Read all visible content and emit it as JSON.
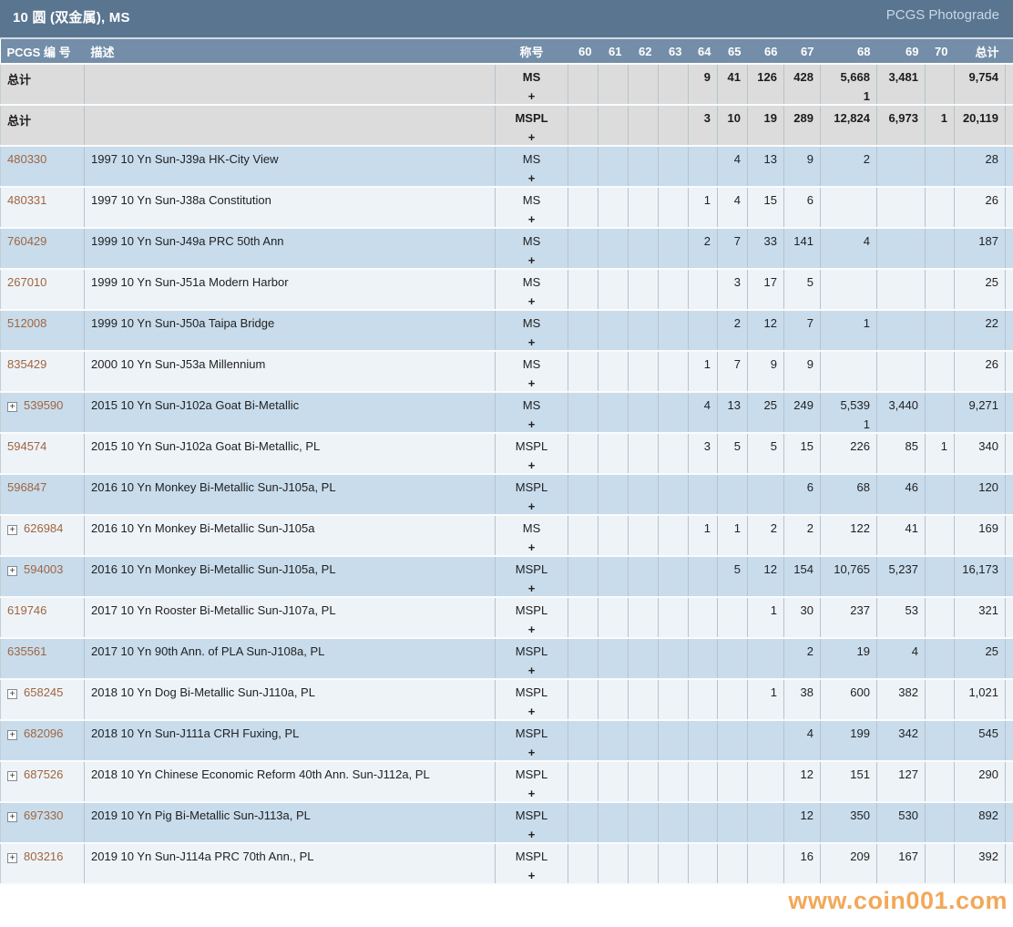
{
  "header": {
    "title": "10 圆 (双金属), MS",
    "photograde_link": "PCGS Photograde"
  },
  "watermark": "www.coin001.com",
  "colors": {
    "titlebar_bg": "#5a7590",
    "table_header_bg": "#748ea9",
    "totals_row_bg": "#dcdcdc",
    "row_blue": "#c8dcec",
    "row_white": "#eef3f8",
    "link": "#a0653f",
    "watermark": "#f09a3e"
  },
  "table": {
    "columns": [
      "PCGS 编 号",
      "描述",
      "称号",
      "60",
      "61",
      "62",
      "63",
      "64",
      "65",
      "66",
      "67",
      "68",
      "69",
      "70",
      "总计"
    ],
    "column_keys": [
      "pcgs",
      "description",
      "designation",
      "60",
      "61",
      "62",
      "63",
      "64",
      "65",
      "66",
      "67",
      "68",
      "69",
      "70",
      "total"
    ],
    "totals_rows": [
      {
        "label": "总计",
        "designation": "MS",
        "plus": "+",
        "values": [
          "",
          "",
          "",
          "",
          "9",
          "41",
          "126",
          "428",
          "5,668",
          "3,481",
          "",
          "9,754"
        ],
        "plus_values": [
          "",
          "",
          "",
          "",
          "",
          "",
          "",
          "",
          "1",
          "",
          "",
          ""
        ]
      },
      {
        "label": "总计",
        "designation": "MSPL",
        "plus": "+",
        "values": [
          "",
          "",
          "",
          "",
          "3",
          "10",
          "19",
          "289",
          "12,824",
          "6,973",
          "1",
          "20,119"
        ],
        "plus_values": [
          "",
          "",
          "",
          "",
          "",
          "",
          "",
          "",
          "",
          "",
          "",
          ""
        ]
      }
    ],
    "rows": [
      {
        "pcgs_number": "480330",
        "expandable": false,
        "description": "1997 10 Yn Sun-J39a HK-City View",
        "designation": "MS",
        "plus": "+",
        "values": [
          "",
          "",
          "",
          "",
          "",
          "4",
          "13",
          "9",
          "2",
          "",
          "",
          "28"
        ],
        "plus_values": [
          "",
          "",
          "",
          "",
          "",
          "",
          "",
          "",
          "",
          "",
          "",
          ""
        ]
      },
      {
        "pcgs_number": "480331",
        "expandable": false,
        "description": "1997 10 Yn Sun-J38a Constitution",
        "designation": "MS",
        "plus": "+",
        "values": [
          "",
          "",
          "",
          "",
          "1",
          "4",
          "15",
          "6",
          "",
          "",
          "",
          "26"
        ],
        "plus_values": [
          "",
          "",
          "",
          "",
          "",
          "",
          "",
          "",
          "",
          "",
          "",
          ""
        ]
      },
      {
        "pcgs_number": "760429",
        "expandable": false,
        "description": "1999 10 Yn Sun-J49a PRC 50th Ann",
        "designation": "MS",
        "plus": "+",
        "values": [
          "",
          "",
          "",
          "",
          "2",
          "7",
          "33",
          "141",
          "4",
          "",
          "",
          "187"
        ],
        "plus_values": [
          "",
          "",
          "",
          "",
          "",
          "",
          "",
          "",
          "",
          "",
          "",
          ""
        ]
      },
      {
        "pcgs_number": "267010",
        "expandable": false,
        "description": "1999 10 Yn Sun-J51a Modern Harbor",
        "designation": "MS",
        "plus": "+",
        "values": [
          "",
          "",
          "",
          "",
          "",
          "3",
          "17",
          "5",
          "",
          "",
          "",
          "25"
        ],
        "plus_values": [
          "",
          "",
          "",
          "",
          "",
          "",
          "",
          "",
          "",
          "",
          "",
          ""
        ]
      },
      {
        "pcgs_number": "512008",
        "expandable": false,
        "description": "1999 10 Yn Sun-J50a Taipa Bridge",
        "designation": "MS",
        "plus": "+",
        "values": [
          "",
          "",
          "",
          "",
          "",
          "2",
          "12",
          "7",
          "1",
          "",
          "",
          "22"
        ],
        "plus_values": [
          "",
          "",
          "",
          "",
          "",
          "",
          "",
          "",
          "",
          "",
          "",
          ""
        ]
      },
      {
        "pcgs_number": "835429",
        "expandable": false,
        "description": "2000 10 Yn Sun-J53a Millennium",
        "designation": "MS",
        "plus": "+",
        "values": [
          "",
          "",
          "",
          "",
          "1",
          "7",
          "9",
          "9",
          "",
          "",
          "",
          "26"
        ],
        "plus_values": [
          "",
          "",
          "",
          "",
          "",
          "",
          "",
          "",
          "",
          "",
          "",
          ""
        ]
      },
      {
        "pcgs_number": "539590",
        "expandable": true,
        "description": "2015 10 Yn Sun-J102a Goat Bi-Metallic",
        "designation": "MS",
        "plus": "+",
        "values": [
          "",
          "",
          "",
          "",
          "4",
          "13",
          "25",
          "249",
          "5,539",
          "3,440",
          "",
          "9,271"
        ],
        "plus_values": [
          "",
          "",
          "",
          "",
          "",
          "",
          "",
          "",
          "1",
          "",
          "",
          ""
        ]
      },
      {
        "pcgs_number": "594574",
        "expandable": false,
        "description": "2015 10 Yn Sun-J102a Goat Bi-Metallic, PL",
        "designation": "MSPL",
        "plus": "+",
        "values": [
          "",
          "",
          "",
          "",
          "3",
          "5",
          "5",
          "15",
          "226",
          "85",
          "1",
          "340"
        ],
        "plus_values": [
          "",
          "",
          "",
          "",
          "",
          "",
          "",
          "",
          "",
          "",
          "",
          ""
        ]
      },
      {
        "pcgs_number": "596847",
        "expandable": false,
        "description": "2016 10 Yn Monkey Bi-Metallic Sun-J105a, PL",
        "designation": "MSPL",
        "plus": "+",
        "values": [
          "",
          "",
          "",
          "",
          "",
          "",
          "",
          "6",
          "68",
          "46",
          "",
          "120"
        ],
        "plus_values": [
          "",
          "",
          "",
          "",
          "",
          "",
          "",
          "",
          "",
          "",
          "",
          ""
        ]
      },
      {
        "pcgs_number": "626984",
        "expandable": true,
        "description": "2016 10 Yn Monkey Bi-Metallic Sun-J105a",
        "designation": "MS",
        "plus": "+",
        "values": [
          "",
          "",
          "",
          "",
          "1",
          "1",
          "2",
          "2",
          "122",
          "41",
          "",
          "169"
        ],
        "plus_values": [
          "",
          "",
          "",
          "",
          "",
          "",
          "",
          "",
          "",
          "",
          "",
          ""
        ]
      },
      {
        "pcgs_number": "594003",
        "expandable": true,
        "description": "2016 10 Yn Monkey Bi-Metallic Sun-J105a, PL",
        "designation": "MSPL",
        "plus": "+",
        "values": [
          "",
          "",
          "",
          "",
          "",
          "5",
          "12",
          "154",
          "10,765",
          "5,237",
          "",
          "16,173"
        ],
        "plus_values": [
          "",
          "",
          "",
          "",
          "",
          "",
          "",
          "",
          "",
          "",
          "",
          ""
        ]
      },
      {
        "pcgs_number": "619746",
        "expandable": false,
        "description": "2017 10 Yn Rooster Bi-Metallic Sun-J107a, PL",
        "designation": "MSPL",
        "plus": "+",
        "values": [
          "",
          "",
          "",
          "",
          "",
          "",
          "1",
          "30",
          "237",
          "53",
          "",
          "321"
        ],
        "plus_values": [
          "",
          "",
          "",
          "",
          "",
          "",
          "",
          "",
          "",
          "",
          "",
          ""
        ]
      },
      {
        "pcgs_number": "635561",
        "expandable": false,
        "description": "2017 10 Yn 90th Ann. of PLA Sun-J108a, PL",
        "designation": "MSPL",
        "plus": "+",
        "values": [
          "",
          "",
          "",
          "",
          "",
          "",
          "",
          "2",
          "19",
          "4",
          "",
          "25"
        ],
        "plus_values": [
          "",
          "",
          "",
          "",
          "",
          "",
          "",
          "",
          "",
          "",
          "",
          ""
        ]
      },
      {
        "pcgs_number": "658245",
        "expandable": true,
        "description": "2018 10 Yn Dog Bi-Metallic Sun-J110a, PL",
        "designation": "MSPL",
        "plus": "+",
        "values": [
          "",
          "",
          "",
          "",
          "",
          "",
          "1",
          "38",
          "600",
          "382",
          "",
          "1,021"
        ],
        "plus_values": [
          "",
          "",
          "",
          "",
          "",
          "",
          "",
          "",
          "",
          "",
          "",
          ""
        ]
      },
      {
        "pcgs_number": "682096",
        "expandable": true,
        "description": "2018 10 Yn Sun-J111a CRH Fuxing, PL",
        "designation": "MSPL",
        "plus": "+",
        "values": [
          "",
          "",
          "",
          "",
          "",
          "",
          "",
          "4",
          "199",
          "342",
          "",
          "545"
        ],
        "plus_values": [
          "",
          "",
          "",
          "",
          "",
          "",
          "",
          "",
          "",
          "",
          "",
          ""
        ]
      },
      {
        "pcgs_number": "687526",
        "expandable": true,
        "description": "2018 10 Yn Chinese Economic Reform 40th Ann. Sun-J112a, PL",
        "designation": "MSPL",
        "plus": "+",
        "values": [
          "",
          "",
          "",
          "",
          "",
          "",
          "",
          "12",
          "151",
          "127",
          "",
          "290"
        ],
        "plus_values": [
          "",
          "",
          "",
          "",
          "",
          "",
          "",
          "",
          "",
          "",
          "",
          ""
        ]
      },
      {
        "pcgs_number": "697330",
        "expandable": true,
        "description": "2019 10 Yn Pig Bi-Metallic Sun-J113a, PL",
        "designation": "MSPL",
        "plus": "+",
        "values": [
          "",
          "",
          "",
          "",
          "",
          "",
          "",
          "12",
          "350",
          "530",
          "",
          "892"
        ],
        "plus_values": [
          "",
          "",
          "",
          "",
          "",
          "",
          "",
          "",
          "",
          "",
          "",
          ""
        ]
      },
      {
        "pcgs_number": "803216",
        "expandable": true,
        "description": "2019 10 Yn Sun-J114a PRC 70th Ann., PL",
        "designation": "MSPL",
        "plus": "+",
        "values": [
          "",
          "",
          "",
          "",
          "",
          "",
          "",
          "16",
          "209",
          "167",
          "",
          "392"
        ],
        "plus_values": [
          "",
          "",
          "",
          "",
          "",
          "",
          "",
          "",
          "",
          "",
          "",
          ""
        ]
      }
    ]
  }
}
